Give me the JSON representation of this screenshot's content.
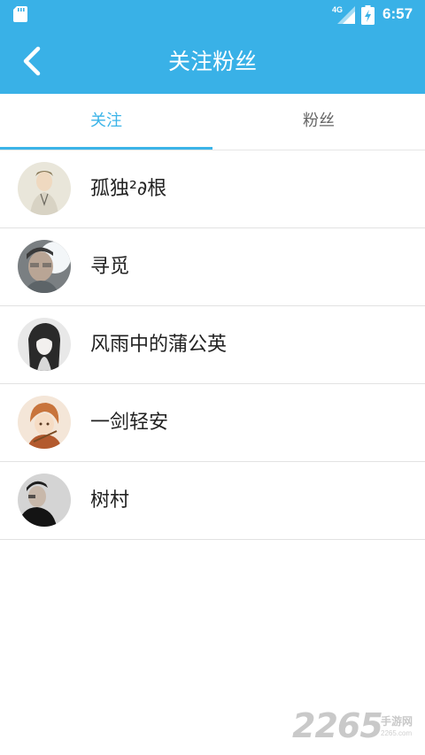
{
  "status_bar": {
    "time": "6:57",
    "network": "4G",
    "icons": [
      "sd-card-icon",
      "signal-icon",
      "battery-charging-icon"
    ]
  },
  "app_bar": {
    "title": "关注粉丝",
    "back_icon": "chevron-left-icon",
    "background_color": "#39b1e7"
  },
  "tabs": [
    {
      "label": "关注",
      "active": true
    },
    {
      "label": "粉丝",
      "active": false
    }
  ],
  "accent_color": "#3bb4e8",
  "users": [
    {
      "name": "孤独²∂根"
    },
    {
      "name": "寻觅"
    },
    {
      "name": "风雨中的蒲公英"
    },
    {
      "name": "一剑轻安"
    },
    {
      "name": "树村"
    }
  ],
  "watermark": {
    "number": "2265",
    "text": "手游网",
    "url": "2265.com"
  }
}
